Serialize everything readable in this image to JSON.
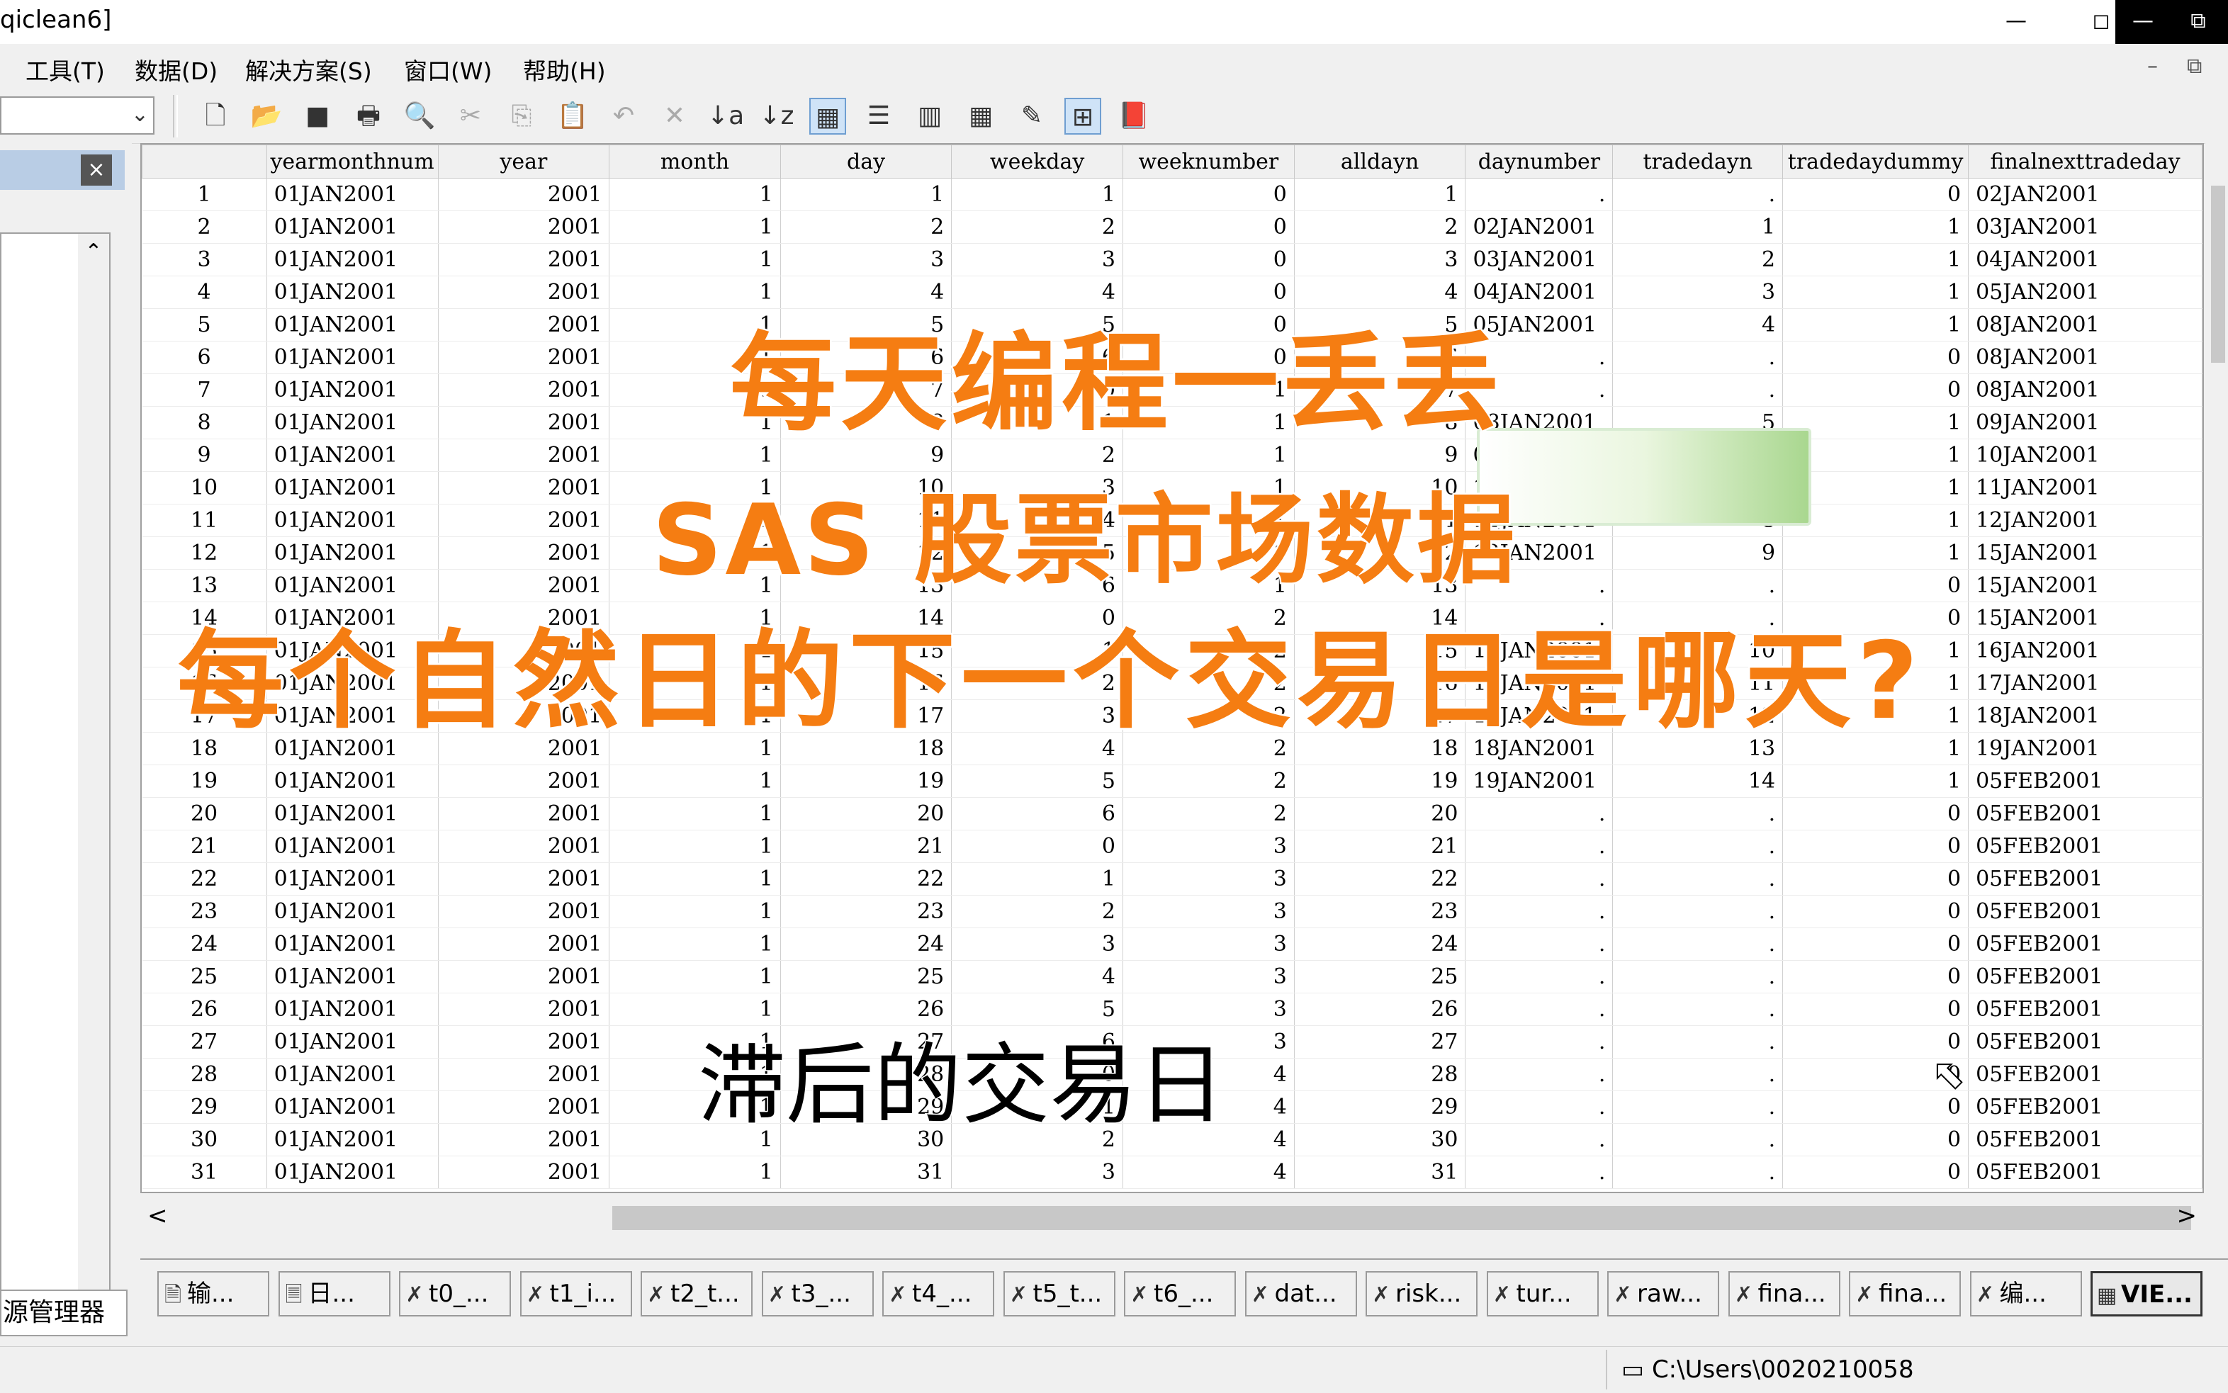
{
  "window": {
    "title_fragment": "qiclean6]",
    "min": "—",
    "restore": "◻",
    "dark_ctrl": [
      "—",
      "⧉"
    ]
  },
  "menu": {
    "items": [
      "工具(T)",
      "数据(D)",
      "解决方案(S)",
      "窗口(W)",
      "帮助(H)"
    ],
    "mdi_min": "–",
    "mdi_restore": "⧉"
  },
  "toolbar": {
    "combo_value": "",
    "icons": [
      {
        "name": "new-icon",
        "glyph": "🗋"
      },
      {
        "name": "open-icon",
        "glyph": "📂"
      },
      {
        "name": "save-icon",
        "glyph": "■"
      },
      {
        "name": "print-icon",
        "glyph": "🖶"
      },
      {
        "name": "print-preview-icon",
        "glyph": "🔍"
      },
      {
        "name": "cut-icon",
        "glyph": "✂"
      },
      {
        "name": "copy-icon",
        "glyph": "⎘"
      },
      {
        "name": "paste-icon",
        "glyph": "📋"
      },
      {
        "name": "undo-icon",
        "glyph": "↶"
      },
      {
        "name": "delete-icon",
        "glyph": "✕"
      },
      {
        "name": "sort-ascending-icon",
        "glyph": "↓a"
      },
      {
        "name": "sort-descending-icon",
        "glyph": "↓z"
      },
      {
        "name": "table-view-icon",
        "glyph": "▦"
      },
      {
        "name": "list-view-icon",
        "glyph": "☰"
      },
      {
        "name": "column-icon",
        "glyph": "▥"
      },
      {
        "name": "grid-icon",
        "glyph": "▦"
      },
      {
        "name": "edit-icon",
        "glyph": "✎"
      },
      {
        "name": "tile-icon",
        "glyph": "⊞"
      },
      {
        "name": "book-icon",
        "glyph": "📕"
      }
    ]
  },
  "explorer": {
    "close_label": "×",
    "tab_label": "源管理器",
    "scroll_up": "⌃",
    "scroll_down": "⌄"
  },
  "table": {
    "columns": [
      "",
      "yearmonthnum",
      "year",
      "month",
      "day",
      "weekday",
      "weeknumber",
      "alldayn",
      "daynumber",
      "tradedayn",
      "tradedaydummy",
      "finalnexttradeday"
    ],
    "rows": [
      [
        "1",
        "01JAN2001",
        "2001",
        "1",
        "1",
        "1",
        "0",
        "1",
        ".",
        ".",
        "0",
        "02JAN2001"
      ],
      [
        "2",
        "01JAN2001",
        "2001",
        "1",
        "2",
        "2",
        "0",
        "2",
        "02JAN2001",
        "1",
        "1",
        "03JAN2001"
      ],
      [
        "3",
        "01JAN2001",
        "2001",
        "1",
        "3",
        "3",
        "0",
        "3",
        "03JAN2001",
        "2",
        "1",
        "04JAN2001"
      ],
      [
        "4",
        "01JAN2001",
        "2001",
        "1",
        "4",
        "4",
        "0",
        "4",
        "04JAN2001",
        "3",
        "1",
        "05JAN2001"
      ],
      [
        "5",
        "01JAN2001",
        "2001",
        "1",
        "5",
        "5",
        "0",
        "5",
        "05JAN2001",
        "4",
        "1",
        "08JAN2001"
      ],
      [
        "6",
        "01JAN2001",
        "2001",
        "1",
        "6",
        "6",
        "0",
        "6",
        ".",
        ".",
        "0",
        "08JAN2001"
      ],
      [
        "7",
        "01JAN2001",
        "2001",
        "1",
        "7",
        "0",
        "1",
        "7",
        ".",
        ".",
        "0",
        "08JAN2001"
      ],
      [
        "8",
        "01JAN2001",
        "2001",
        "1",
        "8",
        "1",
        "1",
        "8",
        "08JAN2001",
        "5",
        "1",
        "09JAN2001"
      ],
      [
        "9",
        "01JAN2001",
        "2001",
        "1",
        "9",
        "2",
        "1",
        "9",
        "09JAN2001",
        "6",
        "1",
        "10JAN2001"
      ],
      [
        "10",
        "01JAN2001",
        "2001",
        "1",
        "10",
        "3",
        "1",
        "10",
        "10JAN2001",
        "7",
        "1",
        "11JAN2001"
      ],
      [
        "11",
        "01JAN2001",
        "2001",
        "1",
        "11",
        "4",
        "1",
        "11",
        "11JAN2001",
        "8",
        "1",
        "12JAN2001"
      ],
      [
        "12",
        "01JAN2001",
        "2001",
        "1",
        "12",
        "5",
        "1",
        "12",
        "12JAN2001",
        "9",
        "1",
        "15JAN2001"
      ],
      [
        "13",
        "01JAN2001",
        "2001",
        "1",
        "13",
        "6",
        "1",
        "13",
        ".",
        ".",
        "0",
        "15JAN2001"
      ],
      [
        "14",
        "01JAN2001",
        "2001",
        "1",
        "14",
        "0",
        "2",
        "14",
        ".",
        ".",
        "0",
        "15JAN2001"
      ],
      [
        "15",
        "01JAN2001",
        "2001",
        "1",
        "15",
        "1",
        "2",
        "15",
        "15JAN2001",
        "10",
        "1",
        "16JAN2001"
      ],
      [
        "16",
        "01JAN2001",
        "2001",
        "1",
        "16",
        "2",
        "2",
        "16",
        "16JAN2001",
        "11",
        "1",
        "17JAN2001"
      ],
      [
        "17",
        "01JAN2001",
        "2001",
        "1",
        "17",
        "3",
        "2",
        "17",
        "17JAN2001",
        "12",
        "1",
        "18JAN2001"
      ],
      [
        "18",
        "01JAN2001",
        "2001",
        "1",
        "18",
        "4",
        "2",
        "18",
        "18JAN2001",
        "13",
        "1",
        "19JAN2001"
      ],
      [
        "19",
        "01JAN2001",
        "2001",
        "1",
        "19",
        "5",
        "2",
        "19",
        "19JAN2001",
        "14",
        "1",
        "05FEB2001"
      ],
      [
        "20",
        "01JAN2001",
        "2001",
        "1",
        "20",
        "6",
        "2",
        "20",
        ".",
        ".",
        "0",
        "05FEB2001"
      ],
      [
        "21",
        "01JAN2001",
        "2001",
        "1",
        "21",
        "0",
        "3",
        "21",
        ".",
        ".",
        "0",
        "05FEB2001"
      ],
      [
        "22",
        "01JAN2001",
        "2001",
        "1",
        "22",
        "1",
        "3",
        "22",
        ".",
        ".",
        "0",
        "05FEB2001"
      ],
      [
        "23",
        "01JAN2001",
        "2001",
        "1",
        "23",
        "2",
        "3",
        "23",
        ".",
        ".",
        "0",
        "05FEB2001"
      ],
      [
        "24",
        "01JAN2001",
        "2001",
        "1",
        "24",
        "3",
        "3",
        "24",
        ".",
        ".",
        "0",
        "05FEB2001"
      ],
      [
        "25",
        "01JAN2001",
        "2001",
        "1",
        "25",
        "4",
        "3",
        "25",
        ".",
        ".",
        "0",
        "05FEB2001"
      ],
      [
        "26",
        "01JAN2001",
        "2001",
        "1",
        "26",
        "5",
        "3",
        "26",
        ".",
        ".",
        "0",
        "05FEB2001"
      ],
      [
        "27",
        "01JAN2001",
        "2001",
        "1",
        "27",
        "6",
        "3",
        "27",
        ".",
        ".",
        "0",
        "05FEB2001"
      ],
      [
        "28",
        "01JAN2001",
        "2001",
        "1",
        "28",
        "0",
        "4",
        "28",
        ".",
        ".",
        "0",
        "05FEB2001"
      ],
      [
        "29",
        "01JAN2001",
        "2001",
        "1",
        "29",
        "1",
        "4",
        "29",
        ".",
        ".",
        "0",
        "05FEB2001"
      ],
      [
        "30",
        "01JAN2001",
        "2001",
        "1",
        "30",
        "2",
        "4",
        "30",
        ".",
        ".",
        "0",
        "05FEB2001"
      ],
      [
        "31",
        "01JAN2001",
        "2001",
        "1",
        "31",
        "3",
        "4",
        "31",
        ".",
        ".",
        "0",
        "05FEB2001"
      ]
    ]
  },
  "scrollbar": {
    "left": "<",
    "right": ">"
  },
  "window_tabs": [
    {
      "label": "输...",
      "icon": "output-window-icon",
      "glyph": "🗎"
    },
    {
      "label": "日...",
      "icon": "log-window-icon",
      "glyph": "🗏"
    },
    {
      "label": "t0_...",
      "icon": "program-icon",
      "glyph": "✗"
    },
    {
      "label": "t1_i...",
      "icon": "program-icon",
      "glyph": "✗"
    },
    {
      "label": "t2_t...",
      "icon": "program-icon",
      "glyph": "✗"
    },
    {
      "label": "t3_...",
      "icon": "program-icon",
      "glyph": "✗"
    },
    {
      "label": "t4_...",
      "icon": "program-icon",
      "glyph": "✗"
    },
    {
      "label": "t5_t...",
      "icon": "program-icon",
      "glyph": "✗"
    },
    {
      "label": "t6_...",
      "icon": "program-icon",
      "glyph": "✗"
    },
    {
      "label": "dat...",
      "icon": "program-icon",
      "glyph": "✗"
    },
    {
      "label": "risk...",
      "icon": "program-icon",
      "glyph": "✗"
    },
    {
      "label": "tur...",
      "icon": "program-icon",
      "glyph": "✗"
    },
    {
      "label": "raw...",
      "icon": "program-icon",
      "glyph": "✗"
    },
    {
      "label": "fina...",
      "icon": "program-icon",
      "glyph": "✗"
    },
    {
      "label": "fina...",
      "icon": "program-icon",
      "glyph": "✗"
    },
    {
      "label": "编...",
      "icon": "program-icon",
      "glyph": "✗"
    },
    {
      "label": "VIE...",
      "icon": "viewtable-icon",
      "glyph": "▦",
      "active": true
    }
  ],
  "status": {
    "path": "C:\\Users\\0020210058",
    "drive_icon": "▭"
  },
  "overlay": {
    "line1": "每天编程一丢丢",
    "line2": "SAS 股票市场数据",
    "line3": "每个自然日的下一个交易日是哪天?",
    "subtitle": "滞后的交易日",
    "cursor": "⬉"
  },
  "colors": {
    "overlay_orange": "#f57d12",
    "highlight_blue": "#cfe3f7"
  }
}
